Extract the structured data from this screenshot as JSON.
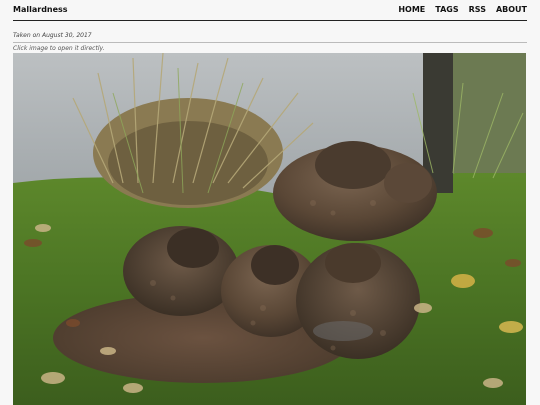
{
  "site": {
    "title": "Mallardness"
  },
  "nav": {
    "items": [
      {
        "label": "HOME"
      },
      {
        "label": "TAGS"
      },
      {
        "label": "RSS"
      },
      {
        "label": "ABOUT"
      }
    ]
  },
  "post": {
    "taken_on": "Taken on August 30, 2017",
    "hint": "Click image to open it directly."
  },
  "colors": {
    "text": "#111111",
    "background": "#f7f7f7",
    "header_rule": "#222222"
  }
}
